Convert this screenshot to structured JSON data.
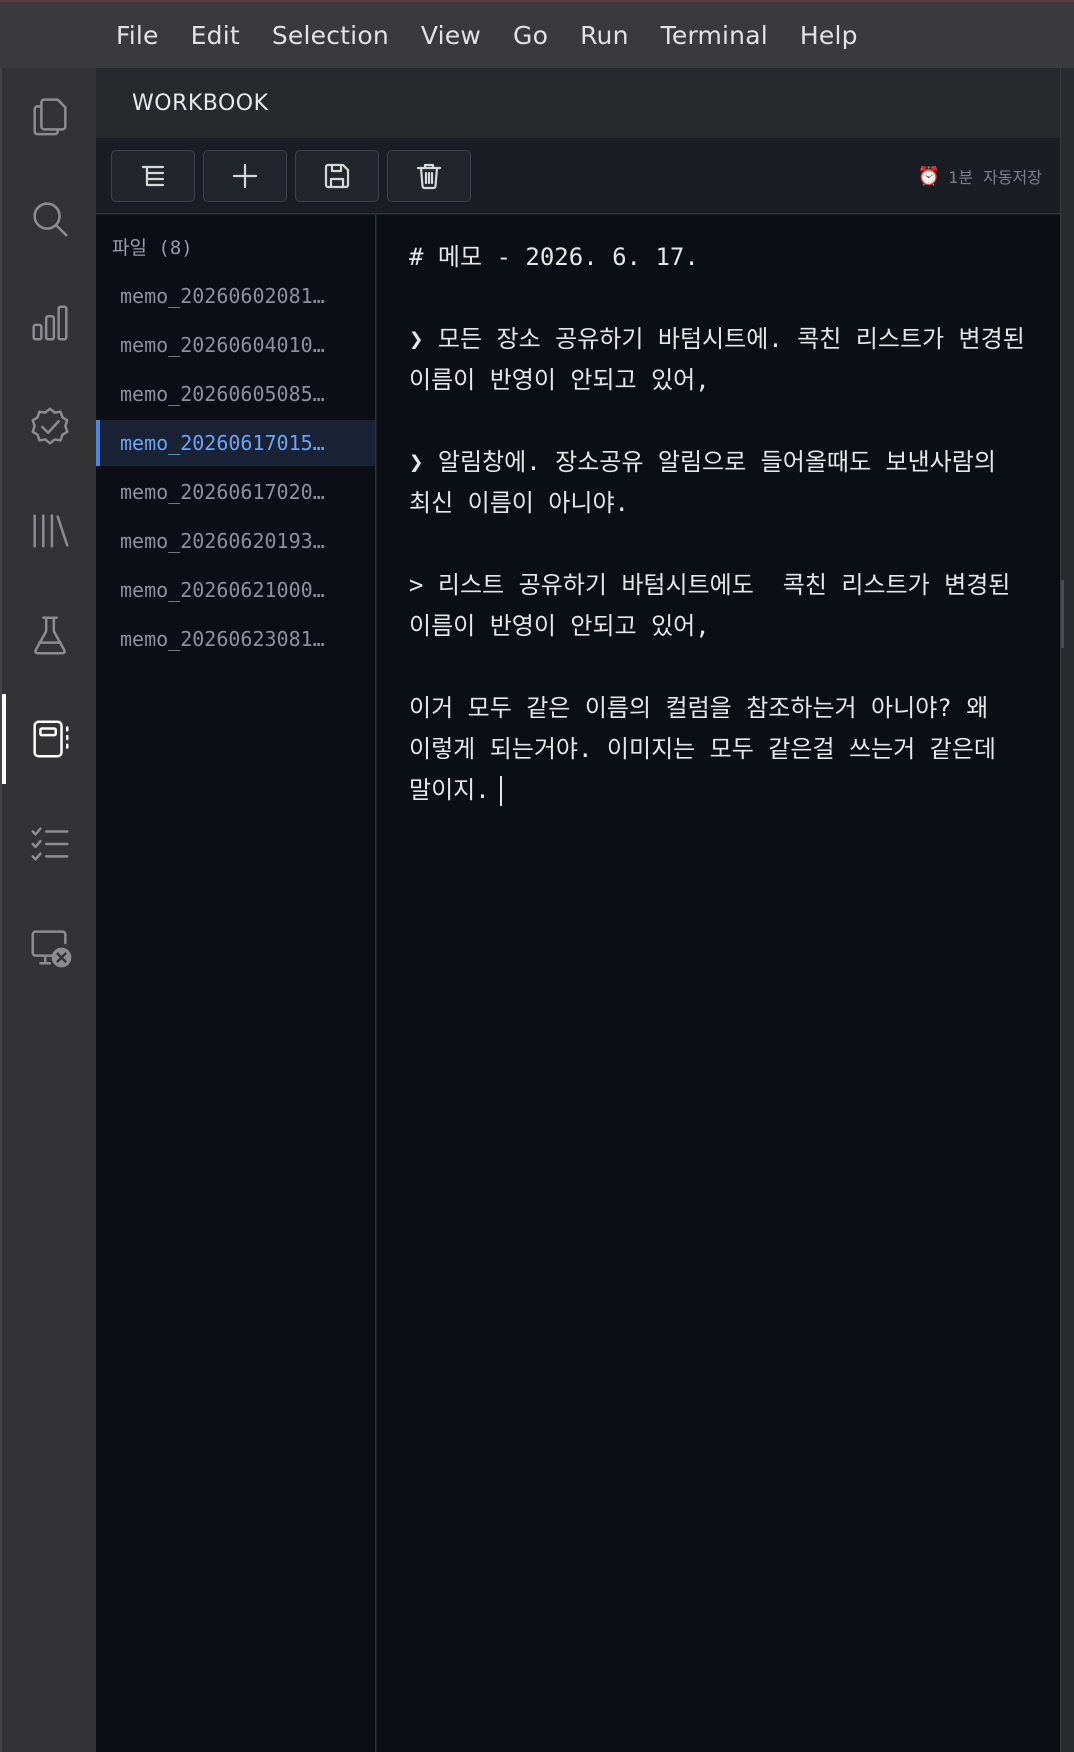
{
  "menu": [
    "File",
    "Edit",
    "Selection",
    "View",
    "Go",
    "Run",
    "Terminal",
    "Help"
  ],
  "activity_bar": [
    {
      "name": "explorer-icon"
    },
    {
      "name": "search-icon"
    },
    {
      "name": "chart-icon"
    },
    {
      "name": "verified-badge-icon"
    },
    {
      "name": "library-icon"
    },
    {
      "name": "flask-icon"
    },
    {
      "name": "notebook-icon",
      "active": true
    },
    {
      "name": "checklist-icon"
    },
    {
      "name": "remote-monitor-icon"
    },
    {
      "name": "settings-gear-icon"
    }
  ],
  "panel": {
    "title": "WORKBOOK"
  },
  "toolbar": {
    "buttons": [
      "outline-icon",
      "plus-icon",
      "save-icon",
      "trash-icon"
    ],
    "autosave": {
      "icon": "⏰",
      "interval": "1분",
      "label": "자동저장"
    }
  },
  "files": {
    "label": "파일 (8)",
    "items": [
      "memo_2026060208​1…",
      "memo_2026060401​0…",
      "memo_2026060508​5…",
      "memo_2026061701​5…",
      "memo_2026061702​0…",
      "memo_2026062019​3…",
      "memo_2026062100​0…",
      "memo_2026062308​1…"
    ],
    "selected_index": 3
  },
  "editor": {
    "text": "# 메모 - 2026. 6. 17.\n\n❯ 모든 장소 공유하기 바텀시트에. 콕친 리스트가 변경된 이름이 반영이 안되고 있어,\n\n❯ 알림창에. 장소공유 알림으로 들어올때도 보낸사람의 최신 이름이 아니야.\n\n> 리스트 공유하기 바텀시트에도  콕친 리스트가 변경된 이름이 반영이 안되고 있어,\n\n이거 모두 같은 이름의 컬럼을 참조하는거 아니야? 왜 이렇게 되는거야. 이미지는 모두 같은걸 쓰는거 같은데 말이지."
  },
  "colors": {
    "accent": "#4f86e0",
    "selected_text": "#6fa3ee",
    "editor_bg": "#0c0e16"
  }
}
